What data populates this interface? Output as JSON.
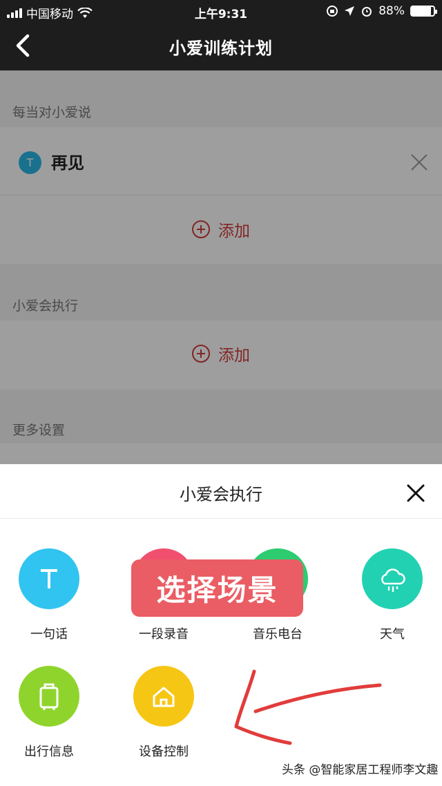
{
  "status_bar": {
    "carrier": "中国移动",
    "time": "上午9:31",
    "battery": "88%",
    "battery_level": 0.88
  },
  "nav": {
    "title": "小爱训练计划",
    "back_icon": "chevron-left-icon"
  },
  "page": {
    "trigger_section_label": "每当对小爱说",
    "phrase_badge": "T",
    "phrase_text": "再见",
    "add_label_1": "添加",
    "action_section_label": "小爱会执行",
    "add_label_2": "添加",
    "more_settings_label": "更多设置"
  },
  "sheet": {
    "title": "小爱会执行",
    "close_icon": "close-icon",
    "options": [
      {
        "label": "一句话",
        "icon": "text-icon",
        "color": "#31c4f0"
      },
      {
        "label": "一段录音",
        "icon": "record-icon",
        "color": "#f0506e"
      },
      {
        "label": "音乐电台",
        "icon": "music-icon",
        "color": "#2dcc70"
      },
      {
        "label": "天气",
        "icon": "weather-cloud-icon",
        "color": "#22d1b2"
      },
      {
        "label": "出行信息",
        "icon": "luggage-icon",
        "color": "#8fd42c"
      },
      {
        "label": "设备控制",
        "icon": "home-icon",
        "color": "#f6c614"
      }
    ]
  },
  "annotation": {
    "banner_text": "选择场景",
    "arrow_icon": "red-hand-drawn-arrow"
  },
  "watermark": {
    "text": "头条 @智能家居工程师李文趣"
  }
}
